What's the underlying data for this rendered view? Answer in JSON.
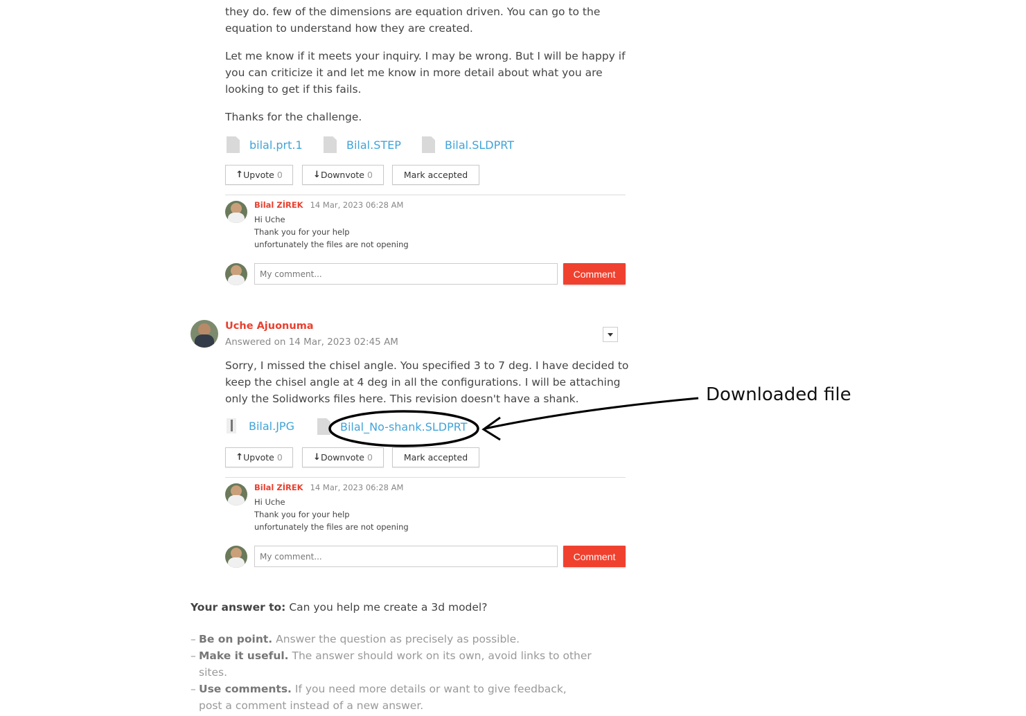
{
  "answer1": {
    "paragraphs": [
      "they do. few of the dimensions are equation driven. You can go to the equation to understand how they are created.",
      "Let me know if it meets your inquiry. I may be wrong. But I will be happy if you can criticize it and let me know in more detail about what you are looking to get if this fails.",
      "Thanks for the challenge."
    ],
    "files": [
      "bilal.prt.1",
      "Bilal.STEP",
      "Bilal.SLDPRT"
    ],
    "upvote_label": "Upvote",
    "upvote_count": "0",
    "downvote_label": "Downvote",
    "downvote_count": "0",
    "accept_label": "Mark accepted",
    "comment": {
      "author": "Bilal ZİREK",
      "date": "14 Mar, 2023 06:28 AM",
      "lines": [
        "Hi Uche",
        "Thank you for your help",
        "unfortunately the files are not opening"
      ]
    },
    "comment_placeholder": "My comment...",
    "comment_button": "Comment"
  },
  "answer2": {
    "author": "Uche Ajuonuma",
    "answered_on": "Answered on 14 Mar, 2023 02:45 AM",
    "paragraph": "Sorry, I missed the chisel angle. You specified 3 to 7 deg. I have decided to keep the chisel angle at 4 deg in all the configurations. I will be attaching only the Solidworks files here. This revision doesn't have a shank.",
    "files": [
      "Bilal.JPG",
      "Bilal_No-shank.SLDPRT"
    ],
    "upvote_label": "Upvote",
    "upvote_count": "0",
    "downvote_label": "Downvote",
    "downvote_count": "0",
    "accept_label": "Mark accepted",
    "comment": {
      "author": "Bilal ZİREK",
      "date": "14 Mar, 2023 06:28 AM",
      "lines": [
        "Hi Uche",
        "Thank you for your help",
        "unfortunately the files are not opening"
      ]
    },
    "comment_placeholder": "My comment...",
    "comment_button": "Comment"
  },
  "annotation": {
    "label": "Downloaded file"
  },
  "your_answer": {
    "prefix": "Your answer to:",
    "question": "Can you help me create a 3d model?",
    "tips": [
      {
        "bold": "Be on point.",
        "text": "Answer the question as precisely as possible."
      },
      {
        "bold": "Make it useful.",
        "text": "The answer should work on its own, avoid links to other sites."
      },
      {
        "bold": "Use comments.",
        "text": "If you need more details or want to give feedback, post a comment instead of a new answer."
      }
    ]
  },
  "colors": {
    "accent_red": "#f0412f",
    "link_blue": "#3fa3d8"
  }
}
